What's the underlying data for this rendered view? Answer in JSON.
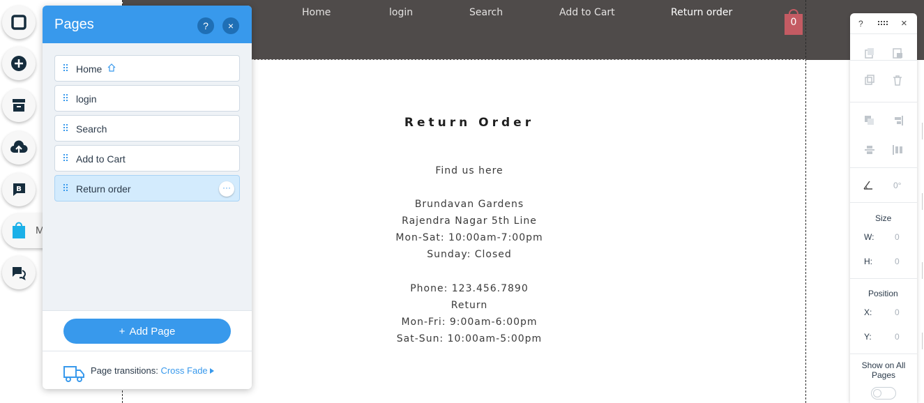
{
  "site": {
    "nav": [
      "Home",
      "login",
      "Search",
      "Add to Cart",
      "Return order"
    ],
    "cart_count": "0"
  },
  "content": {
    "title": "Return Order",
    "find_us": "Find us here",
    "address": [
      "Brundavan Gardens",
      "Rajendra Nagar 5th Line"
    ],
    "hours": [
      "Mon-Sat: 10:00am-7:00pm",
      "Sunday: Closed"
    ],
    "phone": "Phone: 123.456.7890",
    "return": "Return",
    "return_hours": [
      "Mon-Fri: 9:00am-6:00pm",
      "Sat-Sun: 10:00am-5:00pm"
    ]
  },
  "rail": {
    "store_label": "M"
  },
  "pages_panel": {
    "title": "Pages",
    "help": "?",
    "close": "×",
    "pages": [
      {
        "label": "Home",
        "home": true
      },
      {
        "label": "login"
      },
      {
        "label": "Search"
      },
      {
        "label": "Add to Cart"
      },
      {
        "label": "Return order",
        "selected": true
      }
    ],
    "more": "···",
    "add_page": "Add Page",
    "add_prefix": "+",
    "transitions_label": "Page transitions:",
    "transitions_value": "Cross Fade"
  },
  "toolbar": {
    "help": "?",
    "close": "×",
    "rotation": "0°",
    "size_label": "Size",
    "w_label": "W:",
    "w_value": "0",
    "h_label": "H:",
    "h_value": "0",
    "position_label": "Position",
    "x_label": "X:",
    "x_value": "0",
    "y_label": "Y:",
    "y_value": "0",
    "show_all_label": "Show on All Pages",
    "show_all_on": false
  },
  "colors": {
    "header_bg": "#4f4b4a",
    "accent": "#3899ec",
    "cart": "#c45b63"
  }
}
